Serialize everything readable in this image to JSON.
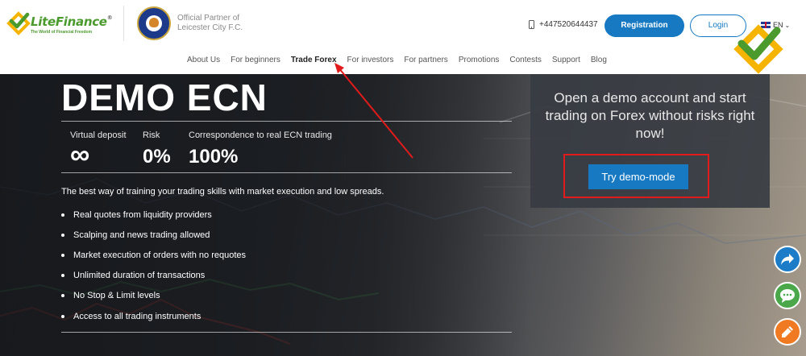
{
  "header": {
    "logo": {
      "name": "LiteFinance",
      "tagline": "The World of Financial Freedom",
      "reg": "®"
    },
    "partner_text": "Official Partner of Leicester City F.C.",
    "phone": "+447520644437",
    "registration_label": "Registration",
    "login_label": "Login",
    "language": "EN"
  },
  "nav": {
    "items": [
      {
        "label": "About Us",
        "active": false
      },
      {
        "label": "For beginners",
        "active": false
      },
      {
        "label": "Trade Forex",
        "active": true
      },
      {
        "label": "For investors",
        "active": false
      },
      {
        "label": "For partners",
        "active": false
      },
      {
        "label": "Promotions",
        "active": false
      },
      {
        "label": "Contests",
        "active": false
      },
      {
        "label": "Support",
        "active": false
      },
      {
        "label": "Blog",
        "active": false
      }
    ]
  },
  "hero": {
    "title": "DEMO ECN",
    "stats": [
      {
        "label": "Virtual deposit",
        "value": "∞"
      },
      {
        "label": "Risk",
        "value": "0%"
      },
      {
        "label": "Correspondence to real ECN trading",
        "value": "100%"
      }
    ],
    "description": "The best way of training your trading skills with market execution and low spreads.",
    "features": [
      "Real quotes from liquidity providers",
      "Scalping and news trading allowed",
      "Market execution of orders with no requotes",
      "Unlimited duration of transactions",
      "No Stop & Limit levels",
      "Access to all trading instruments"
    ]
  },
  "demo_panel": {
    "text": "Open a demo account and start trading on Forex without risks right now!",
    "button_label": "Try demo-mode"
  },
  "colors": {
    "brand_blue": "#1679c2",
    "brand_green": "#4a9a2d",
    "highlight_red": "#e11b1b",
    "panel_bg": "#373c42"
  },
  "icons": {
    "phone": "phone-icon",
    "flag": "uk-flag-icon",
    "share": "share-icon",
    "chat": "chat-icon",
    "edit": "pencil-icon"
  }
}
